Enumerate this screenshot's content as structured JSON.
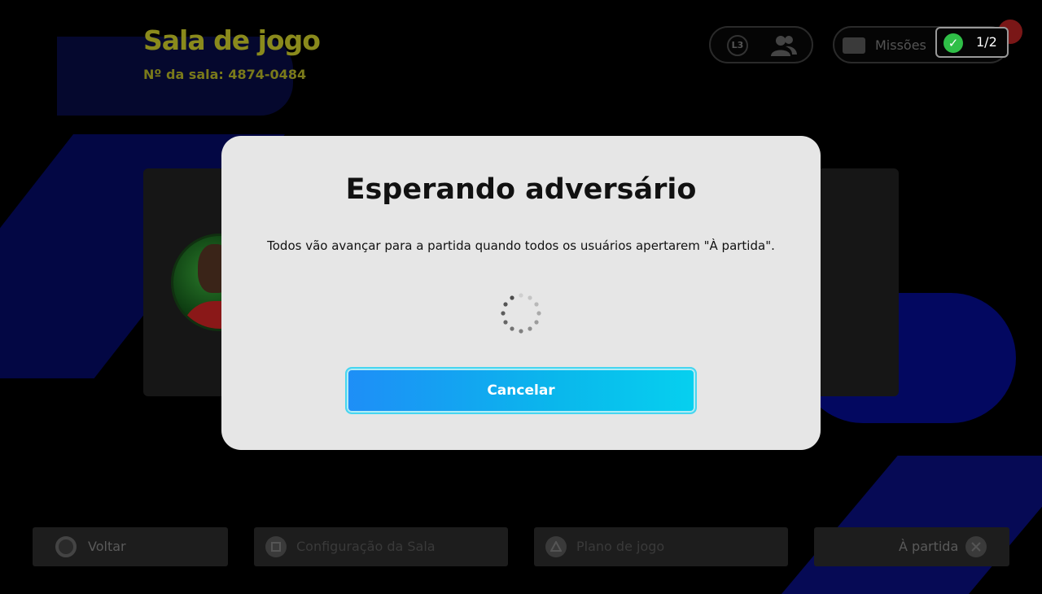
{
  "header": {
    "title": "Sala de jogo",
    "room_number": "Nº da sala: 4874-0484",
    "l3_badge": "L3",
    "missions_label": "Missões",
    "progress": "1/2"
  },
  "modal": {
    "title": "Esperando adversário",
    "message": "Todos vão avançar para a partida quando todos os usuários apertarem \"À partida\".",
    "cancel_label": "Cancelar"
  },
  "footer": {
    "back_label": "Voltar",
    "room_settings_label": "Configuração da Sala",
    "game_plan_label": "Plano de jogo",
    "to_match_label": "À partida"
  },
  "colors": {
    "title": "#8a8a1c",
    "modal_bg": "#e6e6e6",
    "button_start": "#1e8ef7",
    "button_end": "#06d0ef",
    "check": "#2fbf47"
  }
}
